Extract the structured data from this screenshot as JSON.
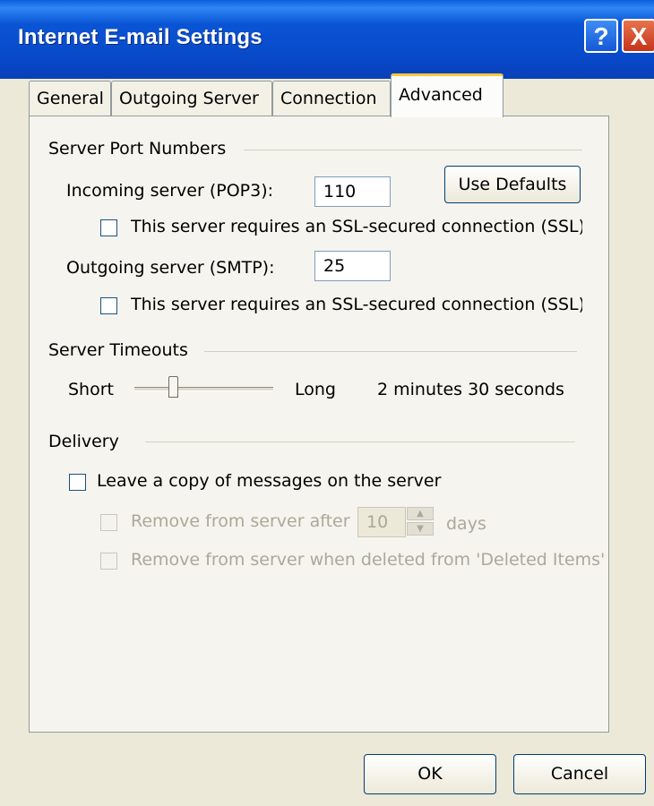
{
  "window": {
    "title": "Internet E-mail Settings"
  },
  "title_buttons": {
    "help": "?",
    "close": "X"
  },
  "tabs": [
    {
      "label": "General",
      "active": false
    },
    {
      "label": "Outgoing Server",
      "active": false
    },
    {
      "label": "Connection",
      "active": false
    },
    {
      "label": "Advanced",
      "active": true
    }
  ],
  "ports": {
    "group_label": "Server Port Numbers",
    "incoming_label": "Incoming server (POP3):",
    "incoming_value": "110",
    "use_defaults_label": "Use Defaults",
    "incoming_ssl_label": "This server requires an SSL-secured connection (SSL)",
    "incoming_ssl_checked": false,
    "outgoing_label": "Outgoing server (SMTP):",
    "outgoing_value": "25",
    "outgoing_ssl_label": "This server requires an SSL-secured connection (SSL)",
    "outgoing_ssl_checked": false
  },
  "timeouts": {
    "group_label": "Server Timeouts",
    "short_label": "Short",
    "long_label": "Long",
    "value_text": "2 minutes 30 seconds",
    "slider_fraction": 0.27
  },
  "delivery": {
    "group_label": "Delivery",
    "leave_copy_label": "Leave a copy of messages on the server",
    "leave_copy_checked": false,
    "remove_after_label": "Remove from server after",
    "remove_after_days": "10",
    "days_label": "days",
    "remove_deleted_label": "Remove from server when deleted from 'Deleted Items'"
  },
  "footer": {
    "ok_label": "OK",
    "cancel_label": "Cancel"
  },
  "colors": {
    "titlebar": "#0a55d5",
    "dialog_bg": "#ece9d8",
    "tab_highlight": "#ffc73c",
    "disabled_text": "#aca899"
  }
}
